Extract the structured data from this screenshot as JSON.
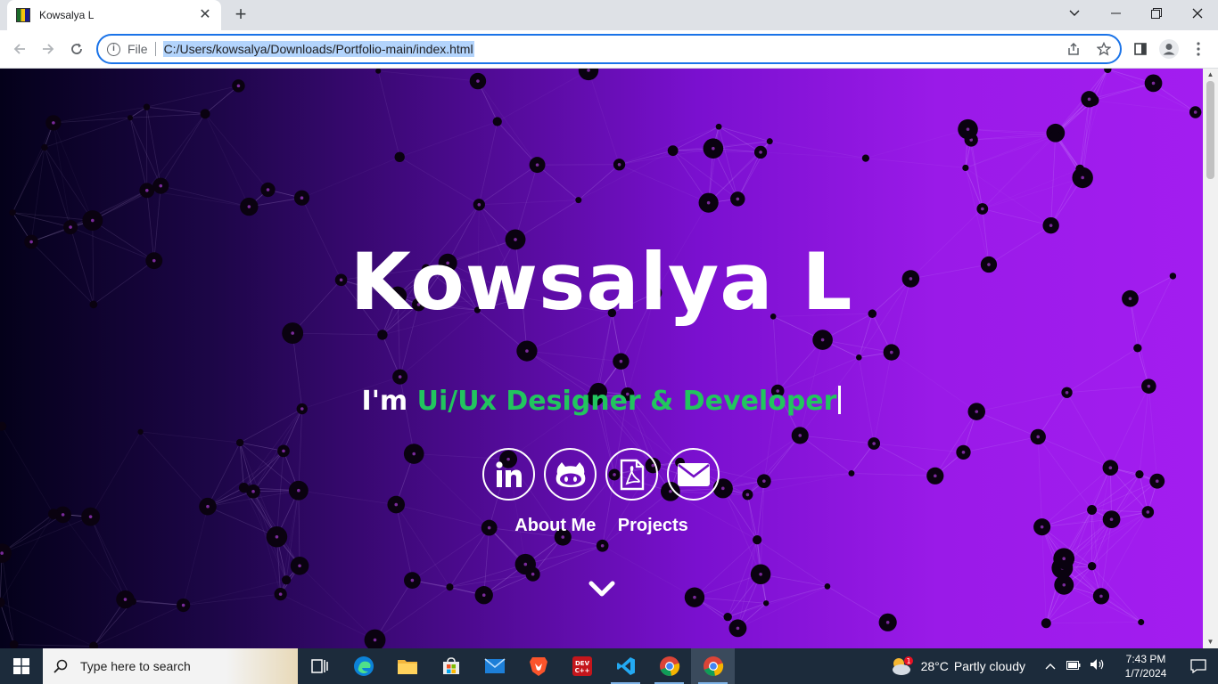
{
  "browser": {
    "tab_title": "Kowsalya L",
    "tab_close": "✕",
    "new_tab": "+",
    "scheme_label": "File",
    "url": "C:/Users/kowsalya/Downloads/Portfolio-main/index.html"
  },
  "hero": {
    "name": "Kowsalya L",
    "prefix": "I'm ",
    "role": "Ui/Ux Designer & Developer"
  },
  "socials": [
    "linkedin-icon",
    "github-icon",
    "pdf-resume-icon",
    "email-icon"
  ],
  "nav": {
    "about": "About Me",
    "projects": "Projects"
  },
  "taskbar": {
    "search_placeholder": "Type here to search",
    "weather_temp": "28°C",
    "weather_desc": "Partly cloudy",
    "weather_badge": "1",
    "time": "7:43 PM",
    "date": "1/7/2024"
  },
  "colors": {
    "accent_green": "#22c55e",
    "omnibox_focus": "#1a73e8",
    "gradient_start": "#04011a",
    "gradient_end": "#a31df0"
  }
}
